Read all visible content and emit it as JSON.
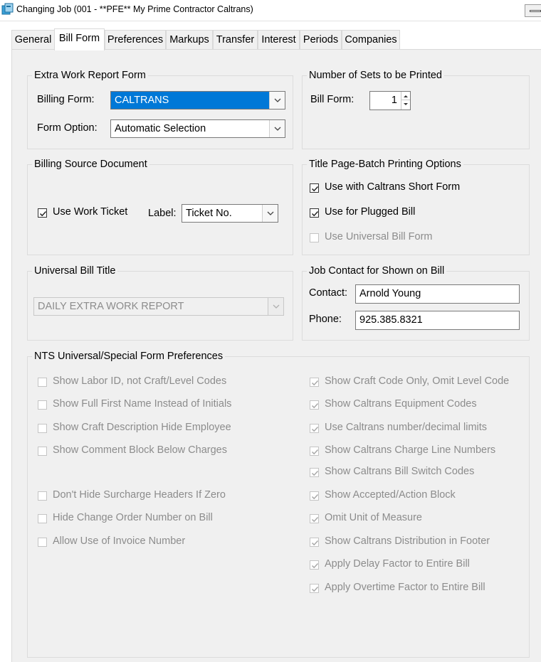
{
  "window": {
    "title": "Changing Job  (001 - **PFE** My Prime Contractor Caltrans)"
  },
  "tabs": [
    {
      "label": "General",
      "active": false
    },
    {
      "label": "Bill Form",
      "active": true
    },
    {
      "label": "Preferences",
      "active": false
    },
    {
      "label": "Markups",
      "active": false
    },
    {
      "label": "Transfer",
      "active": false
    },
    {
      "label": "Interest",
      "active": false
    },
    {
      "label": "Periods",
      "active": false
    },
    {
      "label": "Companies",
      "active": false
    }
  ],
  "extra_work": {
    "title": "Extra Work Report Form",
    "billing_form_label": "Billing Form:",
    "billing_form_value": "CALTRANS",
    "form_option_label": "Form Option:",
    "form_option_value": "Automatic Selection"
  },
  "sets": {
    "title": "Number of Sets to be Printed",
    "bill_form_label": "Bill Form:",
    "bill_form_value": "1"
  },
  "billing_source": {
    "title": "Billing Source Document",
    "use_work_ticket_label": "Use Work Ticket",
    "use_work_ticket_checked": true,
    "label_label": "Label:",
    "label_value": "Ticket No."
  },
  "title_page": {
    "title": "Title Page-Batch Printing Options",
    "options": [
      {
        "label": "Use with Caltrans Short Form",
        "checked": true,
        "enabled": true
      },
      {
        "label": "Use for Plugged Bill",
        "checked": true,
        "enabled": true
      },
      {
        "label": "Use Universal Bill Form",
        "checked": false,
        "enabled": false
      }
    ]
  },
  "universal_title": {
    "title": "Universal Bill Title",
    "value": "DAILY EXTRA WORK REPORT"
  },
  "job_contact": {
    "title": "Job Contact for Shown on Bill",
    "contact_label": "Contact:",
    "contact_value": "Arnold Young",
    "phone_label": "Phone:",
    "phone_value": "925.385.8321"
  },
  "nts": {
    "title": "NTS Universal/Special Form Preferences",
    "left": [
      {
        "label": "Show Labor ID, not Craft/Level Codes",
        "checked": false
      },
      {
        "label": "Show Full First Name Instead of Initials",
        "checked": false
      },
      {
        "label": "Show Craft Description Hide Employee",
        "checked": false
      },
      {
        "label": "Show Comment Block Below Charges",
        "checked": false
      },
      {
        "label": "Don't Hide Surcharge Headers If Zero",
        "checked": false
      },
      {
        "label": "Hide Change Order Number on Bill",
        "checked": false
      },
      {
        "label": "Allow Use of Invoice Number",
        "checked": false
      }
    ],
    "right": [
      {
        "label": "Show Craft Code Only, Omit Level Code",
        "checked": true
      },
      {
        "label": "Show Caltrans Equipment Codes",
        "checked": true
      },
      {
        "label": "Use Caltrans number/decimal limits",
        "checked": true
      },
      {
        "label": "Show Caltrans Charge Line Numbers",
        "checked": true
      },
      {
        "label": "Show Caltrans Bill Switch Codes",
        "checked": true
      },
      {
        "label": "Show Accepted/Action Block",
        "checked": true
      },
      {
        "label": "Omit Unit of Measure",
        "checked": true
      },
      {
        "label": "Show Caltrans Distribution in Footer",
        "checked": true
      },
      {
        "label": "Apply Delay Factor to Entire Bill",
        "checked": true
      },
      {
        "label": "Apply Overtime Factor to Entire Bill",
        "checked": true
      }
    ]
  },
  "colors": {
    "selection": "#0078d7",
    "panel": "#f0f0f0",
    "disabled_text": "#8c8c8c"
  }
}
